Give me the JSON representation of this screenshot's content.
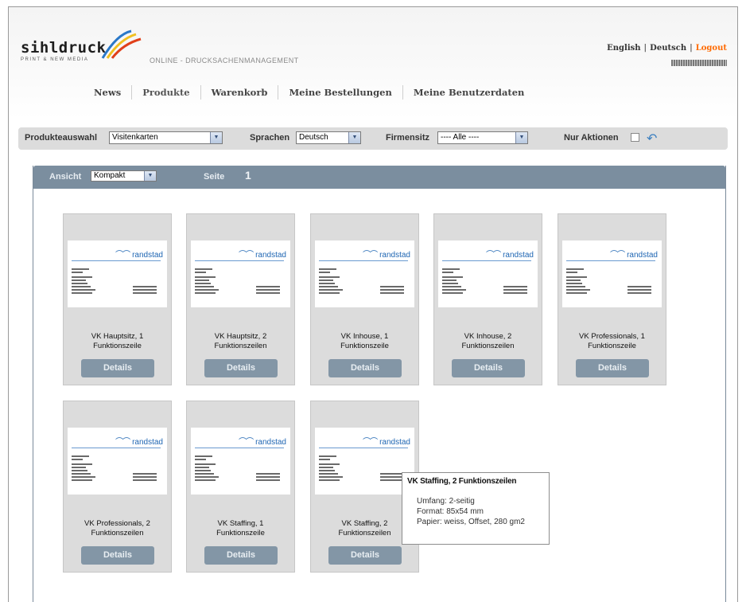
{
  "header": {
    "logo_name": "sihldruck",
    "logo_sub": "PRINT & NEW MEDIA",
    "tagline": "ONLINE - DRUCKSACHENMANAGEMENT",
    "lang_english": "English",
    "lang_deutsch": "Deutsch",
    "logout": "Logout"
  },
  "nav": {
    "items": [
      {
        "label": "News"
      },
      {
        "label": "Produkte"
      },
      {
        "label": "Warenkorb"
      },
      {
        "label": "Meine Bestellungen"
      },
      {
        "label": "Meine Benutzerdaten"
      }
    ],
    "active": "Produkte"
  },
  "filters": {
    "produktauswahl_label": "Produkteauswahl",
    "produktauswahl_value": "Visitenkarten",
    "sprachen_label": "Sprachen",
    "sprachen_value": "Deutsch",
    "firmensitz_label": "Firmensitz",
    "firmensitz_value": "---- Alle ----",
    "nur_aktionen_label": "Nur Aktionen",
    "nur_aktionen_checked": false
  },
  "panel": {
    "ansicht_label": "Ansicht",
    "ansicht_value": "Kompakt",
    "seite_label": "Seite",
    "seite_value": "1"
  },
  "products": [
    {
      "title_line1": "VK Hauptsitz, 1",
      "title_line2": "Funktionszeile",
      "button": "Details",
      "brand": "randstad"
    },
    {
      "title_line1": "VK Hauptsitz, 2",
      "title_line2": "Funktionszeilen",
      "button": "Details",
      "brand": "randstad"
    },
    {
      "title_line1": "VK Inhouse, 1",
      "title_line2": "Funktionszeile",
      "button": "Details",
      "brand": "randstad"
    },
    {
      "title_line1": "VK Inhouse, 2",
      "title_line2": "Funktionszeilen",
      "button": "Details",
      "brand": "randstad"
    },
    {
      "title_line1": "VK Professionals, 1",
      "title_line2": "Funktionszeile",
      "button": "Details",
      "brand": "randstad"
    },
    {
      "title_line1": "VK Professionals, 2",
      "title_line2": "Funktionszeilen",
      "button": "Details",
      "brand": "randstad"
    },
    {
      "title_line1": "VK Staffing, 1",
      "title_line2": "Funktionszeile",
      "button": "Details",
      "brand": "randstad"
    },
    {
      "title_line1": "VK Staffing, 2",
      "title_line2": "Funktionszeilen",
      "button": "Details",
      "brand": "randstad"
    }
  ],
  "tooltip": {
    "title": "VK Staffing, 2 Funktionszeilen",
    "umfang": "Umfang: 2-seitig",
    "format": "Format: 85x54 mm",
    "papier": "Papier: weiss, Offset, 280 gm2"
  },
  "colors": {
    "panel_header": "#7b8e9f",
    "details_button": "#8396a6",
    "brand_blue": "#1f66b3",
    "logout": "#ff6a00"
  }
}
